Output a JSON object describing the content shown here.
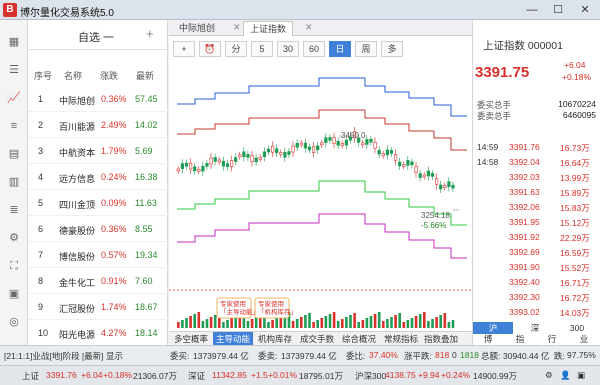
{
  "app": {
    "logo": "B",
    "title": "博尔量化交易系统5.0"
  },
  "watchlist": {
    "title": "自选 一",
    "columns": [
      "序号",
      "名称",
      "涨跌",
      "最新"
    ],
    "rows": [
      {
        "num": "1",
        "name": "中际旭创",
        "pct": "0.36%",
        "price": "57.45"
      },
      {
        "num": "2",
        "name": "百川能源",
        "pct": "2.49%",
        "price": "14.02"
      },
      {
        "num": "3",
        "name": "中航资本",
        "pct": "1.79%",
        "price": "5.69"
      },
      {
        "num": "4",
        "name": "远方信息",
        "pct": "0.24%",
        "price": "16.38"
      },
      {
        "num": "5",
        "name": "四川金顶",
        "pct": "0.09%",
        "price": "11.63"
      },
      {
        "num": "6",
        "name": "德豪股份",
        "pct": "0.36%",
        "price": "8.55"
      },
      {
        "num": "7",
        "name": "博信股份",
        "pct": "0.57%",
        "price": "19.34"
      },
      {
        "num": "8",
        "name": "金牛化工",
        "pct": "0.91%",
        "price": "7.60"
      },
      {
        "num": "9",
        "name": "汇冠股份",
        "pct": "1.74%",
        "price": "18.67"
      },
      {
        "num": "10",
        "name": "阳光电源",
        "pct": "4.27%",
        "price": "18.14"
      }
    ]
  },
  "chart": {
    "tabs": [
      "中际旭创",
      "上证指数"
    ],
    "tools": [
      "+",
      "⏰",
      "分",
      "5",
      "30",
      "60",
      "日",
      "周",
      "多"
    ],
    "active_tool": "日",
    "annotation_high": "3450.0",
    "annotation_low": "3254.18",
    "annotation_low_pct": "-5.66%",
    "bubble1": [
      "专家使用",
      "「主导动能」"
    ],
    "bubble2": [
      "专家使用",
      "「机构库存」"
    ],
    "bottom_tabs": [
      "多空概率",
      "主导动能",
      "机构库存",
      "成交手数",
      "综合概况",
      "常规指标",
      "指数叠加"
    ],
    "active_bottom_tab": "主导动能"
  },
  "chart_data": {
    "type": "candlestick",
    "colors": {
      "blue": "#2a5bd7",
      "red": "#c0392b",
      "green": "#2ecc40",
      "magenta": "#c22ec2"
    }
  },
  "quote": {
    "index_name": "上证指数 000001",
    "price": "3391.75",
    "change": "+6.04",
    "change_pct": "+0.18%",
    "buy_label": "委买总手",
    "buy_value": "10670224",
    "sell_label": "委卖总手",
    "sell_value": "6460095",
    "ticks": [
      {
        "time": "14:59",
        "price": "3391.76",
        "vol": "16.73万"
      },
      {
        "time": "14:58",
        "price": "3392.04",
        "vol": "16.64万"
      },
      {
        "time": "",
        "price": "3392.03",
        "vol": "13.99万"
      },
      {
        "time": "",
        "price": "3391.63",
        "vol": "15.89万"
      },
      {
        "time": "",
        "price": "3392.06",
        "vol": "15.83万"
      },
      {
        "time": "",
        "price": "3391.95",
        "vol": "15.12万"
      },
      {
        "time": "",
        "price": "3391.92",
        "vol": "22.29万"
      },
      {
        "time": "",
        "price": "3392.69",
        "vol": "16.59万"
      },
      {
        "time": "",
        "price": "3391.90",
        "vol": "15.52万"
      },
      {
        "time": "",
        "price": "3392.40",
        "vol": "16.71万"
      },
      {
        "time": "",
        "price": "3392.30",
        "vol": "16.72万"
      },
      {
        "time": "",
        "price": "3393.02",
        "vol": "14.03万"
      }
    ],
    "tabs1": [
      "沪",
      "深",
      "300"
    ],
    "tabs2": [
      "博",
      "指",
      "行",
      "业"
    ]
  },
  "status1": {
    "text": "[21:1:1]业战[地]阶段 [最新] 显示",
    "buy_label": "委买:",
    "buy_value": "1373979.44 亿",
    "sell_label": "委卖:",
    "sell_value": "1373979.44 亿",
    "ratio_label": "委比:",
    "ratio_value": "37.40%",
    "up_label": "涨平跌:",
    "up_value": "818",
    "zero_value": "0",
    "down_value": "1818",
    "amount_label": "总额:",
    "amount_value": "30940.44 亿",
    "drop_label": "跌:",
    "drop_value": "97.75%"
  },
  "status2": {
    "sh_label": "上证",
    "sh_price": "3391.76",
    "sh_chg": "+6.04",
    "sh_pct": "+0.18%",
    "sh_amt": "21306.07万",
    "sz_label": "深证",
    "sz_price": "11342.85",
    "sz_chg": "+1.5",
    "sz_pct": "+0.01%",
    "sz_amt": "18795.01万",
    "hs_label": "沪深300",
    "hs_price": "4138.75",
    "hs_chg": "+9.94",
    "hs_pct": "+0.24%",
    "hs_amt": "14900.99万"
  }
}
